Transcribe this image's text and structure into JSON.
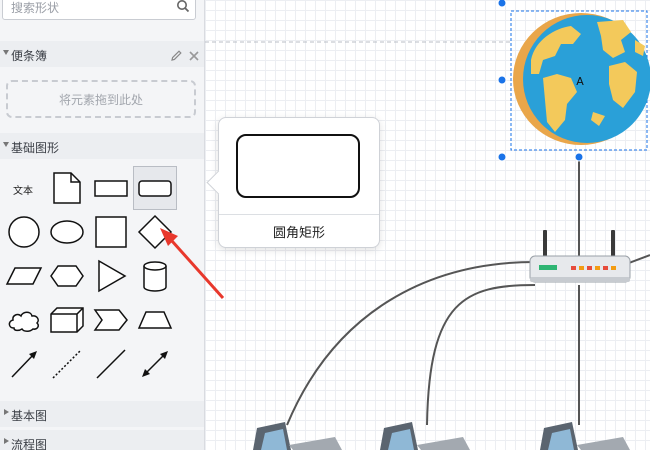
{
  "sidebar": {
    "search": {
      "placeholder": "搜索形状"
    },
    "sections": {
      "scratchpad": {
        "label": "便条簿",
        "drop_hint": "将元素拖到此处"
      },
      "basic_shapes": {
        "label": "基础图形",
        "text_shape_label": "文本"
      },
      "basic_diagram": {
        "label": "基本图"
      },
      "flowchart": {
        "label": "流程图"
      }
    }
  },
  "tooltip": {
    "caption": "圆角矩形"
  },
  "canvas": {
    "globe_label": "A"
  },
  "colors": {
    "accent_blue": "#1a73e8",
    "globe_ocean": "#2aa0d8",
    "globe_land": "#f3c95b",
    "arrow_red": "#e8382c"
  }
}
